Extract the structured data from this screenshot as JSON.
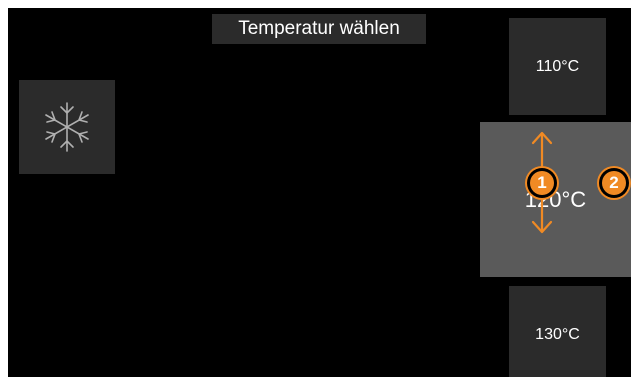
{
  "header": {
    "title": "Temperatur wählen"
  },
  "mode": {
    "icon": "snowflake-icon"
  },
  "temperatures": {
    "previous": "110°C",
    "current": "120°C",
    "next": "130°C"
  },
  "annotations": {
    "marker_1": "1",
    "marker_2": "2",
    "arrows_icon": "up-down-arrows-icon"
  },
  "colors": {
    "background": "#000000",
    "tile": "#2b2b2b",
    "selected_tile": "#5a5a5a",
    "annotation": "#f08a24",
    "text": "#ffffff",
    "icon": "#b0b0b0"
  }
}
